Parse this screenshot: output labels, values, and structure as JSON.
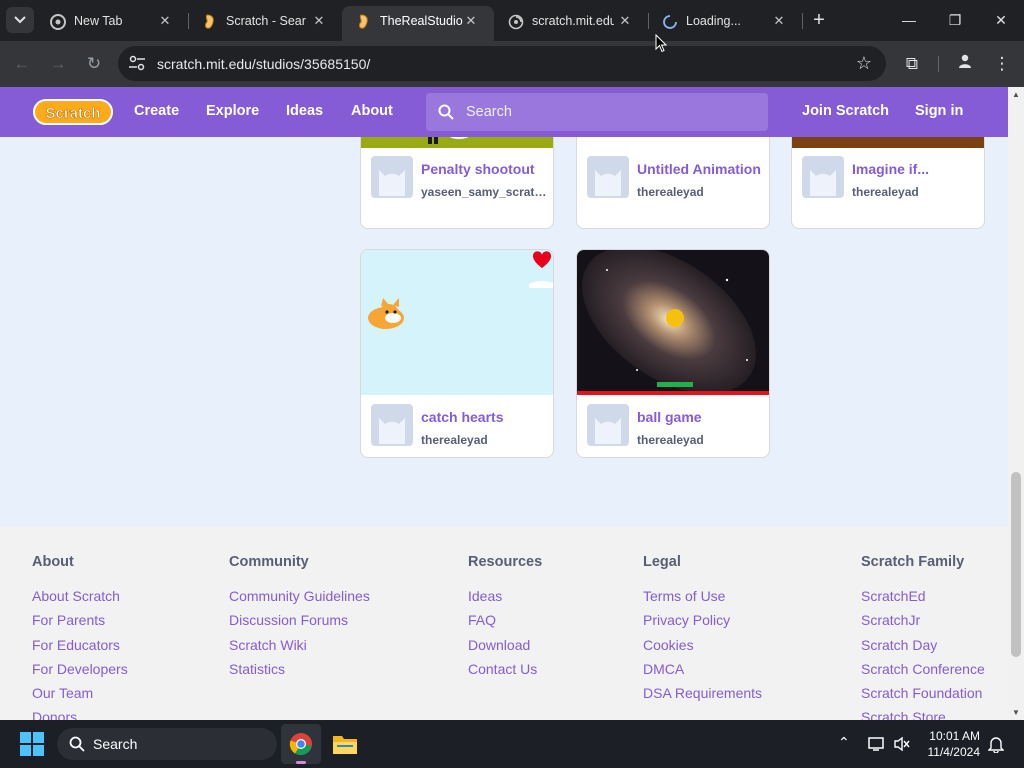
{
  "browser": {
    "tabs": [
      {
        "title": "New Tab",
        "icon": "chrome-icon",
        "active": false
      },
      {
        "title": "Scratch - Search",
        "icon": "scratch-icon",
        "active": false
      },
      {
        "title": "TheRealStudio",
        "icon": "scratch-icon",
        "active": true
      },
      {
        "title": "scratch.mit.edu",
        "icon": "globe-icon",
        "active": false
      },
      {
        "title": "Loading...",
        "icon": "loading-icon",
        "active": false
      }
    ],
    "url": "scratch.mit.edu/studios/35685150/"
  },
  "navbar": {
    "logo": "Scratch",
    "links": [
      "Create",
      "Explore",
      "Ideas",
      "About"
    ],
    "search_placeholder": "Search",
    "join": "Join Scratch",
    "signin": "Sign in",
    "color": "#855cd6"
  },
  "projects": [
    {
      "title": "Penalty shootout",
      "author": "yaseen_samy_scratch"
    },
    {
      "title": "Untitled Animation",
      "author": "therealeyad"
    },
    {
      "title": "Imagine if...",
      "author": "therealeyad"
    },
    {
      "title": "catch hearts",
      "author": "therealeyad"
    },
    {
      "title": "ball game",
      "author": "therealeyad"
    }
  ],
  "footer": {
    "columns": [
      {
        "heading": "About",
        "links": [
          "About Scratch",
          "For Parents",
          "For Educators",
          "For Developers",
          "Our Team",
          "Donors"
        ]
      },
      {
        "heading": "Community",
        "links": [
          "Community Guidelines",
          "Discussion Forums",
          "Scratch Wiki",
          "Statistics"
        ]
      },
      {
        "heading": "Resources",
        "links": [
          "Ideas",
          "FAQ",
          "Download",
          "Contact Us"
        ]
      },
      {
        "heading": "Legal",
        "links": [
          "Terms of Use",
          "Privacy Policy",
          "Cookies",
          "DMCA",
          "DSA Requirements"
        ]
      },
      {
        "heading": "Scratch Family",
        "links": [
          "ScratchEd",
          "ScratchJr",
          "Scratch Day",
          "Scratch Conference",
          "Scratch Foundation",
          "Scratch Store"
        ]
      }
    ]
  },
  "taskbar": {
    "search_placeholder": "Search",
    "time": "10:01 AM",
    "date": "11/4/2024"
  }
}
